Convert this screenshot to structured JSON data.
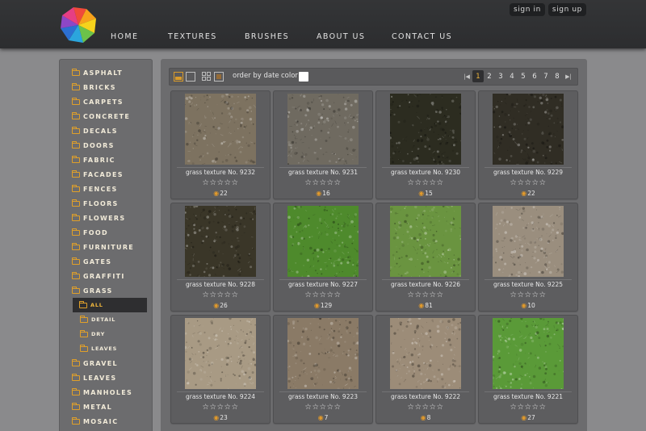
{
  "header": {
    "nav": [
      "HOME",
      "TEXTURES",
      "BRUSHES",
      "ABOUT US",
      "CONTACT US"
    ],
    "auth": [
      "sign in",
      "sign up"
    ]
  },
  "sidebar": {
    "categories": [
      {
        "label": "ASPHALT",
        "level": 0
      },
      {
        "label": "BRICKS",
        "level": 0
      },
      {
        "label": "CARPETS",
        "level": 0
      },
      {
        "label": "CONCRETE",
        "level": 0
      },
      {
        "label": "DECALS",
        "level": 0
      },
      {
        "label": "DOORS",
        "level": 0
      },
      {
        "label": "FABRIC",
        "level": 0
      },
      {
        "label": "FACADES",
        "level": 0
      },
      {
        "label": "FENCES",
        "level": 0
      },
      {
        "label": "FLOORS",
        "level": 0
      },
      {
        "label": "FLOWERS",
        "level": 0
      },
      {
        "label": "FOOD",
        "level": 0
      },
      {
        "label": "FURNITURE",
        "level": 0
      },
      {
        "label": "GATES",
        "level": 0
      },
      {
        "label": "GRAFFITI",
        "level": 0
      },
      {
        "label": "GRASS",
        "level": 0
      },
      {
        "label": "ALL",
        "level": 1,
        "active": true
      },
      {
        "label": "DETAIL",
        "level": 1
      },
      {
        "label": "DRY",
        "level": 1
      },
      {
        "label": "LEAVES",
        "level": 1
      },
      {
        "label": "GRAVEL",
        "level": 0
      },
      {
        "label": "LEAVES",
        "level": 0
      },
      {
        "label": "MANHOLES",
        "level": 0
      },
      {
        "label": "METAL",
        "level": 0
      },
      {
        "label": "MOSAIC",
        "level": 0
      }
    ]
  },
  "toolbar": {
    "order_label": "order by date",
    "color_label": "color",
    "selected_color": "#ffffff",
    "pages": [
      "1",
      "2",
      "3",
      "4",
      "5",
      "6",
      "7",
      "8"
    ],
    "current_page": "1",
    "first_icon": "first-page-icon",
    "last_icon": "last-page-icon"
  },
  "textures": [
    {
      "title": "grass texture No. 9232",
      "views": "22",
      "rating": 0,
      "color": "#7d7260"
    },
    {
      "title": "grass texture No. 9231",
      "views": "16",
      "rating": 0,
      "color": "#6f6a60"
    },
    {
      "title": "grass texture No. 9230",
      "views": "15",
      "rating": 0,
      "color": "#2c2c20"
    },
    {
      "title": "grass texture No. 9229",
      "views": "22",
      "rating": 0,
      "color": "#302d24"
    },
    {
      "title": "grass texture No. 9228",
      "views": "26",
      "rating": 0,
      "color": "#3a3628"
    },
    {
      "title": "grass texture No. 9227",
      "views": "129",
      "rating": 0,
      "color": "#4e8a2c"
    },
    {
      "title": "grass texture No. 9226",
      "views": "81",
      "rating": 0,
      "color": "#6a9440"
    },
    {
      "title": "grass texture No. 9225",
      "views": "10",
      "rating": 0,
      "color": "#9a8e7e"
    },
    {
      "title": "grass texture No. 9224",
      "views": "23",
      "rating": 0,
      "color": "#a89a84"
    },
    {
      "title": "grass texture No. 9223",
      "views": "7",
      "rating": 0,
      "color": "#8a7a66"
    },
    {
      "title": "grass texture No. 9222",
      "views": "8",
      "rating": 0,
      "color": "#9c8c78"
    },
    {
      "title": "grass texture No. 9221",
      "views": "27",
      "rating": 0,
      "color": "#5a9a38"
    }
  ]
}
